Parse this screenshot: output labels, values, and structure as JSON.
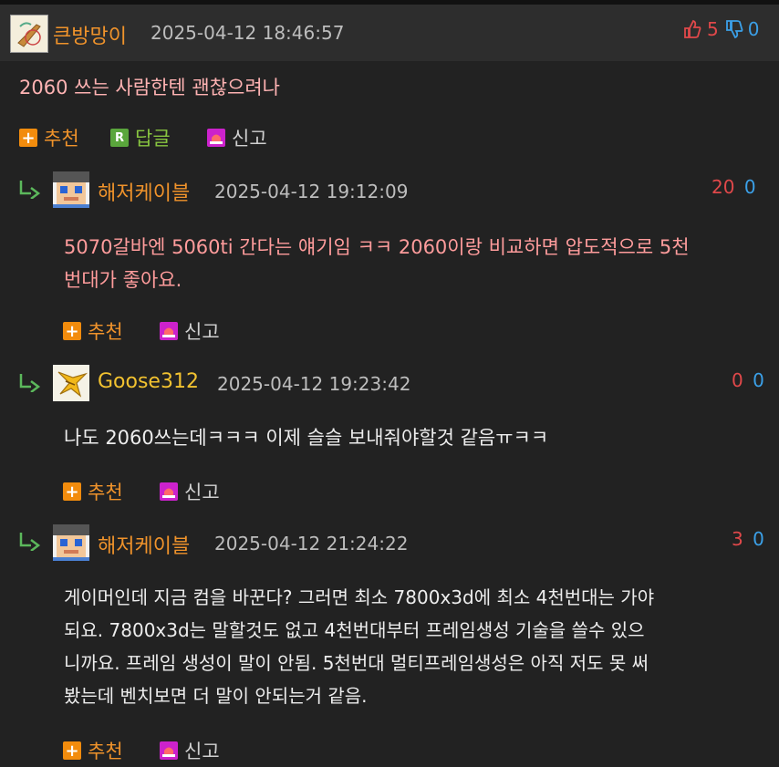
{
  "post": {
    "nick": "큰방망이",
    "date": "2025-04-12 18:46:57",
    "up": "5",
    "down": "0",
    "content": "2060 쓰는 사람한텐 괜찮으려나",
    "actions": {
      "recommend": "추천",
      "reply": "답글",
      "report": "신고"
    }
  },
  "replies": [
    {
      "nick": "해저케이블",
      "date": "2025-04-12 19:12:09",
      "up": "20",
      "down": "0",
      "lines": [
        "5070갈바엔 5060ti 간다는 얘기임 ㅋㅋ 2060이랑 비교하면 압도적으로 5천",
        "번대가 좋아요."
      ],
      "recommend": "추천",
      "report": "신고"
    },
    {
      "nick": "Goose312",
      "date": "2025-04-12 19:23:42",
      "up": "0",
      "down": "0",
      "lines": [
        "나도 2060쓰는데ㅋㅋㅋ 이제 슬슬 보내줘야할것 같음ㅠㅋㅋ"
      ],
      "recommend": "추천",
      "report": "신고"
    },
    {
      "nick": "해저케이블",
      "date": "2025-04-12 21:24:22",
      "up": "3",
      "down": "0",
      "lines": [
        "게이머인데 지금 컴을 바꾼다? 그러면 최소 7800x3d에 최소 4천번대는 가야",
        "되요. 7800x3d는 말할것도 없고 4천번대부터 프레임생성 기술을 쓸수 있으",
        "니까요. 프레임 생성이 말이 안됨. 5천번대 멀티프레임생성은 아직 저도 못 써",
        "봤는데 벤치보면 더 말이 안되는거 같음."
      ],
      "recommend": "추천",
      "report": "신고"
    }
  ]
}
